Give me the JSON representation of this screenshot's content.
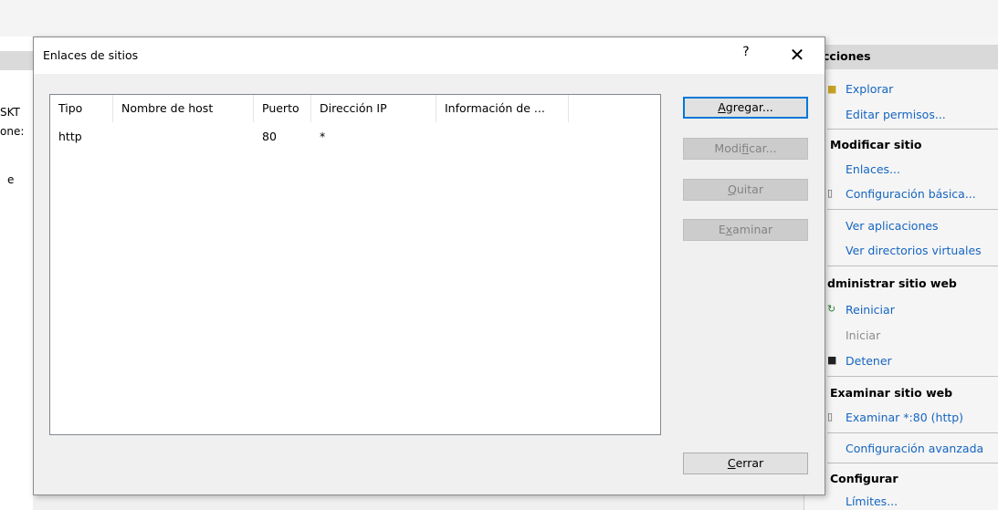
{
  "background": {
    "left_pane": {
      "lines": [
        "SKT",
        "one:",
        "e"
      ]
    },
    "actions_pane": {
      "header": "cciones",
      "items": [
        {
          "label": "Explorar",
          "enabled": true
        },
        {
          "label": "Editar permisos...",
          "enabled": true
        },
        {
          "label": "Modificar sitio",
          "section": true
        },
        {
          "label": "Enlaces...",
          "enabled": true
        },
        {
          "label": "Configuración básica...",
          "enabled": true
        },
        {
          "label": "Ver aplicaciones",
          "enabled": true
        },
        {
          "label": "Ver directorios virtuales",
          "enabled": true
        },
        {
          "label": "dministrar sitio web",
          "section": true
        },
        {
          "label": "Reiniciar",
          "enabled": true
        },
        {
          "label": "Iniciar",
          "enabled": false
        },
        {
          "label": "Detener",
          "enabled": true
        },
        {
          "label": "Examinar sitio web",
          "section": true
        },
        {
          "label": "Examinar *:80 (http)",
          "enabled": true
        },
        {
          "label": "Configuración avanzada",
          "enabled": true
        },
        {
          "label": "Configurar",
          "section": true
        },
        {
          "label": "Límites...",
          "enabled": true
        }
      ]
    }
  },
  "dialog": {
    "title": "Enlaces de sitios",
    "help_label": "?",
    "close_label": "✕",
    "columns": [
      "Tipo",
      "Nombre de host",
      "Puerto",
      "Dirección IP",
      "Información de ..."
    ],
    "rows": [
      [
        "http",
        "",
        "80",
        "*",
        ""
      ]
    ],
    "buttons": {
      "add": {
        "pre": "",
        "key": "A",
        "post": "gregar..."
      },
      "modify": {
        "pre": "Modi",
        "key": "f",
        "post": "icar..."
      },
      "remove": {
        "pre": "",
        "key": "Q",
        "post": "uitar"
      },
      "browse": {
        "pre": "E",
        "key": "x",
        "post": "aminar"
      },
      "close": {
        "pre": "",
        "key": "C",
        "post": "errar"
      }
    }
  }
}
